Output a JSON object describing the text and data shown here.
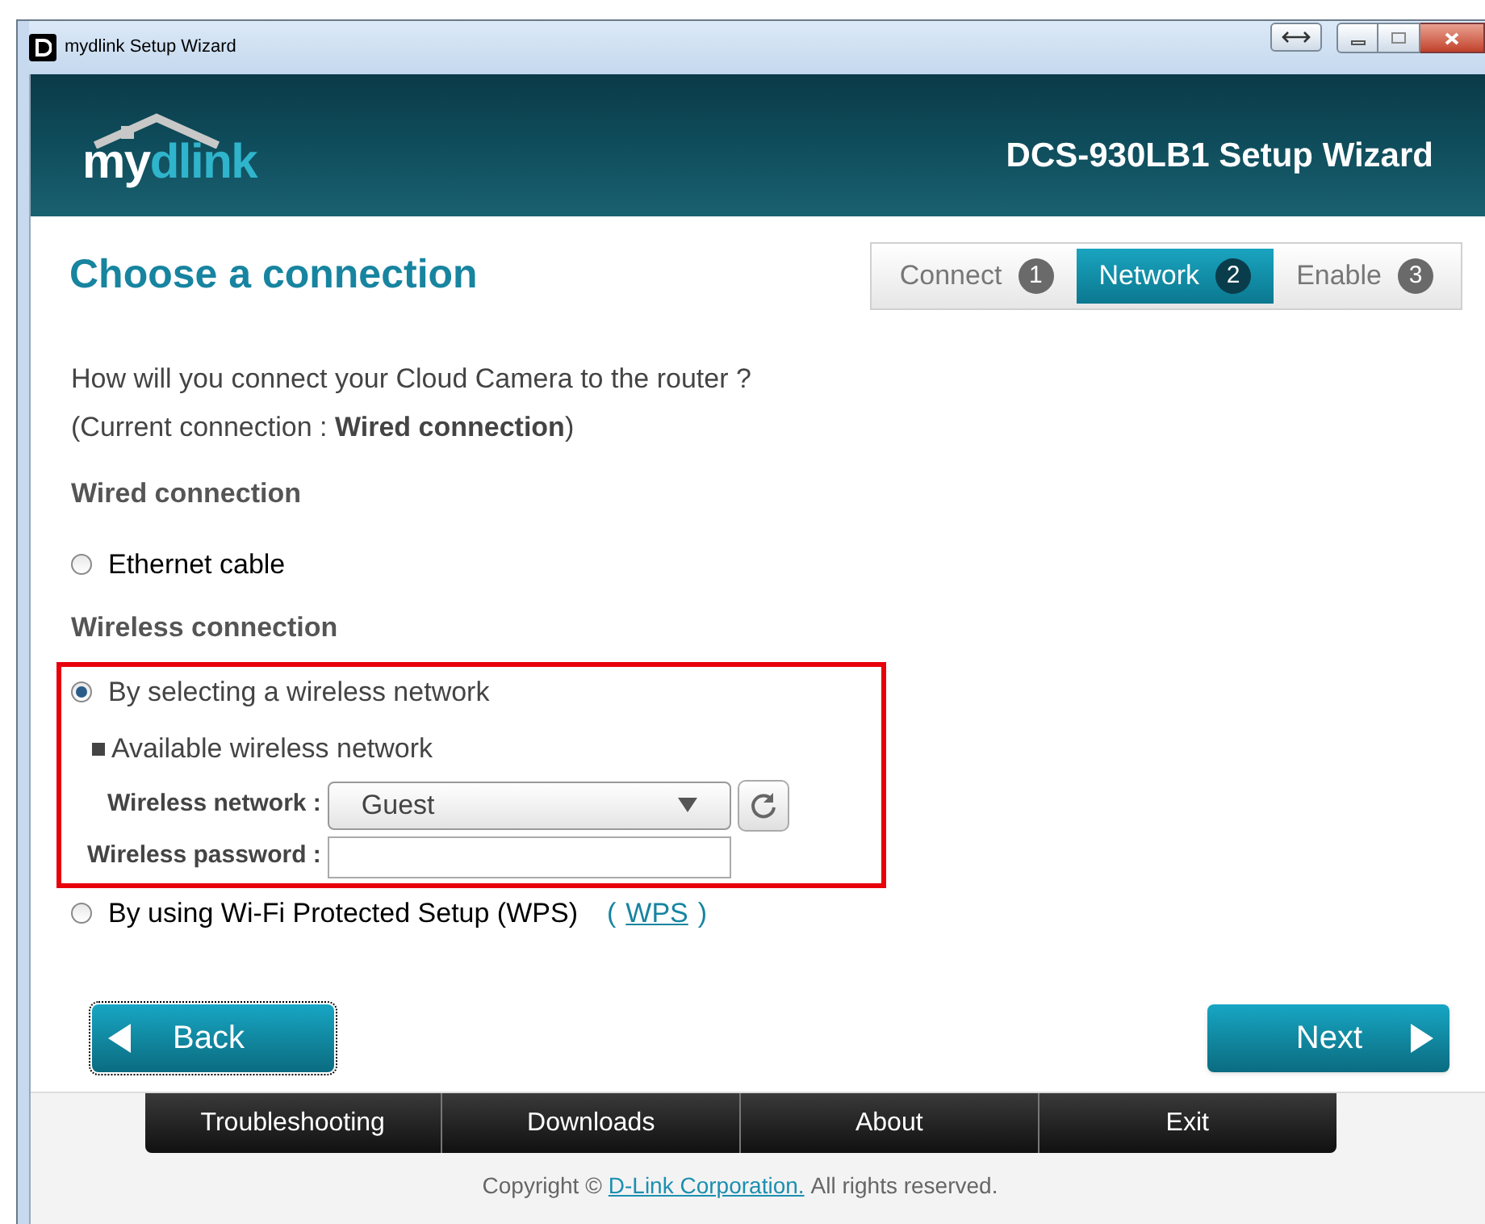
{
  "window": {
    "title": "mydlink Setup Wizard"
  },
  "header": {
    "logo": {
      "part_1": "my",
      "part_2": "dlink"
    },
    "title": "DCS-930LB1 Setup Wizard"
  },
  "page_title": "Choose a connection",
  "steps": [
    {
      "label": "Connect",
      "number": "1",
      "selected": false
    },
    {
      "label": "Network",
      "number": "2",
      "selected": true
    },
    {
      "label": "Enable",
      "number": "3",
      "selected": false
    }
  ],
  "question": "How will you connect your Cloud Camera to the router ?",
  "current_connection": "(Current connection : **Wired connection**)",
  "wired": {
    "heading": "Wired connection",
    "options": [
      {
        "label": "Ethernet cable",
        "selected": false
      }
    ]
  },
  "wireless": {
    "heading": "Wireless connection",
    "select_option": {
      "label": "By selecting a wireless network",
      "selected": true
    },
    "available_heading": "Available wireless network",
    "network_label": "Wireless network :",
    "network_value": "Guest",
    "password_label": "Wireless password :",
    "wps_option": {
      "label": "By using Wi-Fi Protected Setup (WPS)",
      "selected": false,
      "link_open": "(",
      "link": "WPS",
      "link_close": ")"
    }
  },
  "buttons": {
    "back": "Back",
    "next": "Next"
  },
  "footer_menu": [
    "Troubleshooting",
    "Downloads",
    "About",
    "Exit"
  ],
  "copyright": {
    "before": "Copyright ©",
    "link": "D-Link Corporation.",
    "after": "All rights reserved."
  }
}
